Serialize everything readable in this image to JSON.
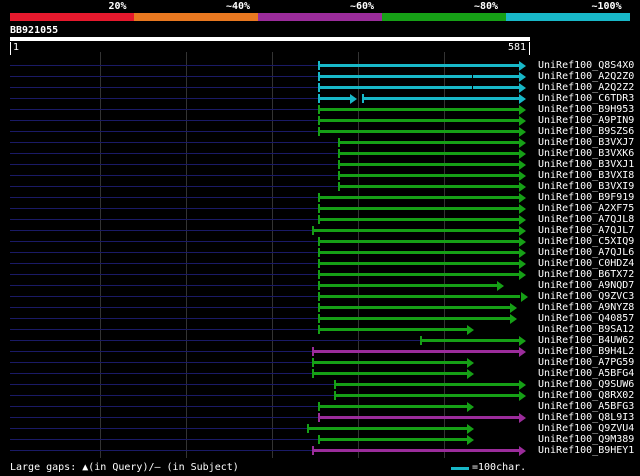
{
  "legend": [
    {
      "label": "20%",
      "color": "#e6192d"
    },
    {
      "label": "~40%",
      "color": "#e87820"
    },
    {
      "label": "~60%",
      "color": "#9b2c9b"
    },
    {
      "label": "~80%",
      "color": "#16a016"
    },
    {
      "label": "~100%",
      "color": "#18b8c8"
    }
  ],
  "query": {
    "id": "BB921055",
    "start": "1",
    "end": "581"
  },
  "hits": [
    {
      "id": "UniRef100_Q8S4X0",
      "color": "#18b8c8",
      "start": 318,
      "end": 526
    },
    {
      "id": "UniRef100_A2Q2Z0",
      "color": "#18b8c8",
      "start": 318,
      "end": 526,
      "tick": 472
    },
    {
      "id": "UniRef100_A2Q2Z2",
      "color": "#18b8c8",
      "start": 318,
      "end": 526,
      "tick": 472
    },
    {
      "id": "UniRef100_C6TDR3",
      "color": "#18b8c8",
      "start": 318,
      "end": 526,
      "gap": [
        354,
        362
      ]
    },
    {
      "id": "UniRef100_B9H953",
      "color": "#16a016",
      "start": 318,
      "end": 526
    },
    {
      "id": "UniRef100_A9PIN9",
      "color": "#16a016",
      "start": 318,
      "end": 526
    },
    {
      "id": "UniRef100_B9SZS6",
      "color": "#16a016",
      "start": 318,
      "end": 526
    },
    {
      "id": "UniRef100_B3VXJ7",
      "color": "#16a016",
      "start": 338,
      "end": 526
    },
    {
      "id": "UniRef100_B3VXK6",
      "color": "#16a016",
      "start": 338,
      "end": 526
    },
    {
      "id": "UniRef100_B3VXJ1",
      "color": "#16a016",
      "start": 338,
      "end": 526
    },
    {
      "id": "UniRef100_B3VXI8",
      "color": "#16a016",
      "start": 338,
      "end": 526
    },
    {
      "id": "UniRef100_B3VXI9",
      "color": "#16a016",
      "start": 338,
      "end": 526
    },
    {
      "id": "UniRef100_B9F919",
      "color": "#16a016",
      "start": 318,
      "end": 526
    },
    {
      "id": "UniRef100_A2XF75",
      "color": "#16a016",
      "start": 318,
      "end": 526
    },
    {
      "id": "UniRef100_A7QJL8",
      "color": "#16a016",
      "start": 318,
      "end": 526
    },
    {
      "id": "UniRef100_A7QJL7",
      "color": "#16a016",
      "start": 312,
      "end": 526
    },
    {
      "id": "UniRef100_C5XIQ9",
      "color": "#16a016",
      "start": 318,
      "end": 526
    },
    {
      "id": "UniRef100_A7QJL6",
      "color": "#16a016",
      "start": 318,
      "end": 526
    },
    {
      "id": "UniRef100_C0HDZ4",
      "color": "#16a016",
      "start": 318,
      "end": 526
    },
    {
      "id": "UniRef100_B6TX72",
      "color": "#16a016",
      "start": 318,
      "end": 526
    },
    {
      "id": "UniRef100_A9NQD7",
      "color": "#16a016",
      "start": 318,
      "end": 504
    },
    {
      "id": "UniRef100_Q9ZVC3",
      "color": "#16a016",
      "start": 318,
      "end": 528,
      "tick": 520
    },
    {
      "id": "UniRef100_A9NYZ8",
      "color": "#16a016",
      "start": 318,
      "end": 517
    },
    {
      "id": "UniRef100_Q40857",
      "color": "#16a016",
      "start": 318,
      "end": 517
    },
    {
      "id": "UniRef100_B9SA12",
      "color": "#16a016",
      "start": 318,
      "end": 474
    },
    {
      "id": "UniRef100_B4UW62",
      "color": "#16a016",
      "start": 420,
      "end": 526
    },
    {
      "id": "UniRef100_B9H4L2",
      "color": "#9b2c9b",
      "start": 312,
      "end": 526
    },
    {
      "id": "UniRef100_A7PG59",
      "color": "#16a016",
      "start": 312,
      "end": 474
    },
    {
      "id": "UniRef100_A5BFG4",
      "color": "#16a016",
      "start": 312,
      "end": 474
    },
    {
      "id": "UniRef100_Q9SUW6",
      "color": "#16a016",
      "start": 334,
      "end": 526
    },
    {
      "id": "UniRef100_Q8RX02",
      "color": "#16a016",
      "start": 334,
      "end": 526
    },
    {
      "id": "UniRef100_A5BFG3",
      "color": "#16a016",
      "start": 318,
      "end": 474
    },
    {
      "id": "UniRef100_Q8L9I3",
      "color": "#9b2c9b",
      "start": 318,
      "end": 526
    },
    {
      "id": "UniRef100_Q9ZVU4",
      "color": "#16a016",
      "start": 307,
      "end": 474
    },
    {
      "id": "UniRef100_Q9M389",
      "color": "#16a016",
      "start": 318,
      "end": 474
    },
    {
      "id": "UniRef100_B9HEY1",
      "color": "#9b2c9b",
      "start": 312,
      "end": 526
    }
  ],
  "footer": {
    "gap_text": "Large gaps: ▲(in Query)/– (in Subject)",
    "scale_text": "=100char.",
    "scale_color": "#18b8c8"
  }
}
